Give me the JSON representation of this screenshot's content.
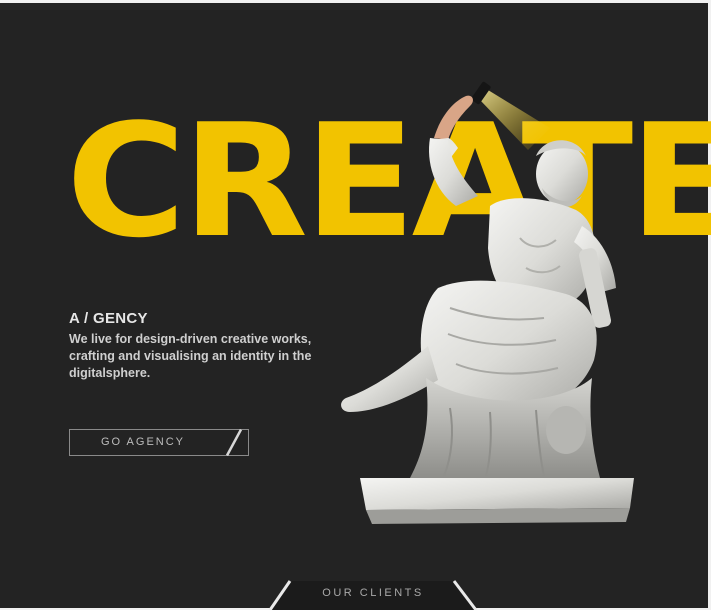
{
  "hero": {
    "headline": "CREATE"
  },
  "agency": {
    "title": "A / GENCY",
    "description": "We live for design-driven creative works, crafting and visualising an identity in the digitalsphere."
  },
  "cta": {
    "label": "GO AGENCY"
  },
  "footer_tab": {
    "label": "OUR CLIENTS"
  },
  "colors": {
    "background": "#232323",
    "accent": "#f2c300",
    "text": "#e6e6e6"
  },
  "images": {
    "statue": "marble-statue-taking-selfie"
  }
}
